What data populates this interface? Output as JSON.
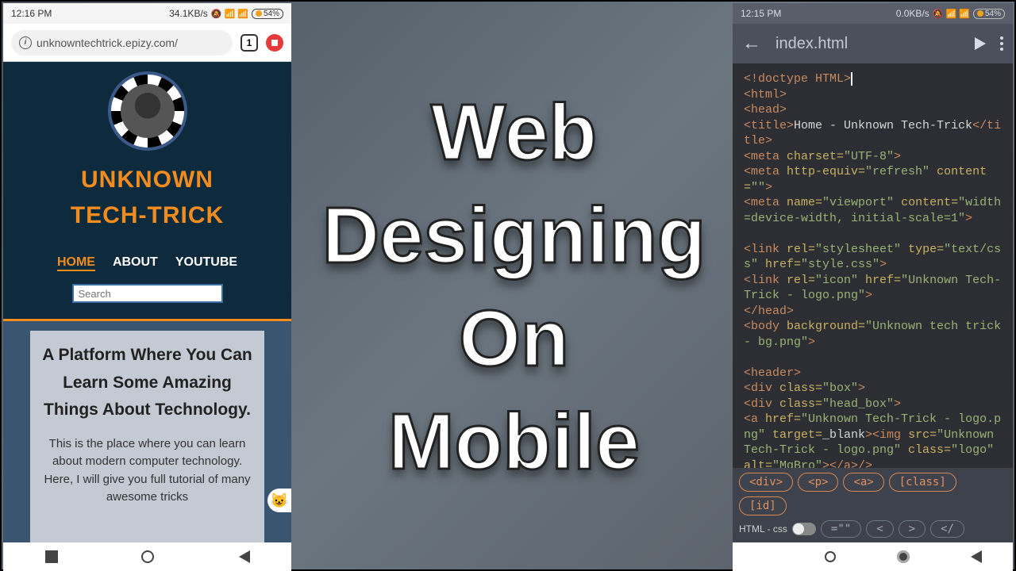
{
  "center_title": {
    "line1": "Web",
    "line2": "Designing",
    "line3": "On",
    "line4": "Mobile"
  },
  "left_phone": {
    "status": {
      "time": "12:16 PM",
      "speed": "34.1KB/s",
      "battery": "54%"
    },
    "browser": {
      "url": "unknowntechtrick.epizy.com/",
      "tab_count": "1"
    },
    "site": {
      "title_line1": "UNKNOWN",
      "title_line2": "TECH-TRICK",
      "nav": {
        "home": "HOME",
        "about": "ABOUT",
        "youtube": "YOUTUBE"
      },
      "search_placeholder": "Search",
      "headline": "A Platform Where You Can Learn Some Amazing Things About Technology.",
      "paragraph": "This is the place where you can learn about modern computer technology. Here, I will give you full tutorial of many awesome tricks"
    }
  },
  "right_phone": {
    "status": {
      "time": "12:15 PM",
      "speed": "0.0KB/s",
      "battery": "54%"
    },
    "editor": {
      "filename": "index.html",
      "helpers": {
        "div": "<div>",
        "p": "<p>",
        "a": "<a>",
        "class": "[class]",
        "id": "[id]",
        "mode": "HTML - css",
        "eq": "=\"\"",
        "lt": "<",
        "gt": ">",
        "close": "</"
      },
      "code_lines": [
        {
          "t": "tag",
          "raw": "<!doctype HTML>"
        },
        {
          "t": "tag",
          "raw": "<html>"
        },
        {
          "t": "tag",
          "raw": "<head>"
        },
        {
          "t": "mix",
          "parts": [
            [
              "tag",
              "<title>"
            ],
            [
              "txt",
              "Home - Unknown Tech-Trick"
            ],
            [
              "tag",
              "</title>"
            ]
          ]
        },
        {
          "t": "mix",
          "parts": [
            [
              "tag",
              "<meta "
            ],
            [
              "attr",
              "charset="
            ],
            [
              "val",
              "\"UTF-8\""
            ],
            [
              "tag",
              ">"
            ]
          ]
        },
        {
          "t": "mix",
          "parts": [
            [
              "tag",
              "<meta "
            ],
            [
              "attr",
              "http-equiv="
            ],
            [
              "val",
              "\"refresh\" "
            ],
            [
              "attr",
              "content="
            ],
            [
              "val",
              "\"\""
            ],
            [
              "tag",
              ">"
            ]
          ]
        },
        {
          "t": "mix",
          "parts": [
            [
              "tag",
              "<meta "
            ],
            [
              "attr",
              "name="
            ],
            [
              "val",
              "\"viewport\" "
            ],
            [
              "attr",
              "content="
            ],
            [
              "val",
              "\"width=device-width, initial-scale=1\""
            ],
            [
              "tag",
              ">"
            ]
          ]
        },
        {
          "t": "blank"
        },
        {
          "t": "mix",
          "parts": [
            [
              "tag",
              "<link "
            ],
            [
              "attr",
              "rel="
            ],
            [
              "val",
              "\"stylesheet\" "
            ],
            [
              "attr",
              "type="
            ],
            [
              "val",
              "\"text/css\" "
            ],
            [
              "attr",
              "href="
            ],
            [
              "val",
              "\"style.css\""
            ],
            [
              "tag",
              ">"
            ]
          ]
        },
        {
          "t": "mix",
          "parts": [
            [
              "tag",
              "<link "
            ],
            [
              "attr",
              "rel="
            ],
            [
              "val",
              "\"icon\" "
            ],
            [
              "attr",
              "href="
            ],
            [
              "val",
              "\"Unknown Tech-Trick - logo.png\""
            ],
            [
              "tag",
              ">"
            ]
          ]
        },
        {
          "t": "tag",
          "raw": "</head>"
        },
        {
          "t": "mix",
          "parts": [
            [
              "tag",
              "<body "
            ],
            [
              "attr",
              "background="
            ],
            [
              "val",
              "\"Unknown tech trick - bg.png\""
            ],
            [
              "tag",
              ">"
            ]
          ]
        },
        {
          "t": "blank"
        },
        {
          "t": "tag",
          "raw": "<header>"
        },
        {
          "t": "mix",
          "parts": [
            [
              "tag",
              "<div "
            ],
            [
              "attr",
              "class="
            ],
            [
              "val",
              "\"box\""
            ],
            [
              "tag",
              ">"
            ]
          ]
        },
        {
          "t": "mix",
          "parts": [
            [
              "tag",
              "<div "
            ],
            [
              "attr",
              "class="
            ],
            [
              "val",
              "\"head_box\""
            ],
            [
              "tag",
              ">"
            ]
          ]
        },
        {
          "t": "mix",
          "parts": [
            [
              "tag",
              "<a "
            ],
            [
              "attr",
              "href="
            ],
            [
              "val",
              "\"Unknown Tech-Trick - logo.png\" "
            ],
            [
              "attr",
              "target="
            ],
            [
              "txt",
              "_blank"
            ],
            [
              "tag",
              "><img "
            ],
            [
              "attr",
              "src="
            ],
            [
              "val",
              "\"Unknown Tech-Trick - logo.png\" "
            ],
            [
              "attr",
              "class="
            ],
            [
              "val",
              "\"logo\" "
            ],
            [
              "attr",
              "alt="
            ],
            [
              "val",
              "\"MgBro\""
            ],
            [
              "tag",
              "></a>/>"
            ]
          ]
        }
      ]
    }
  }
}
